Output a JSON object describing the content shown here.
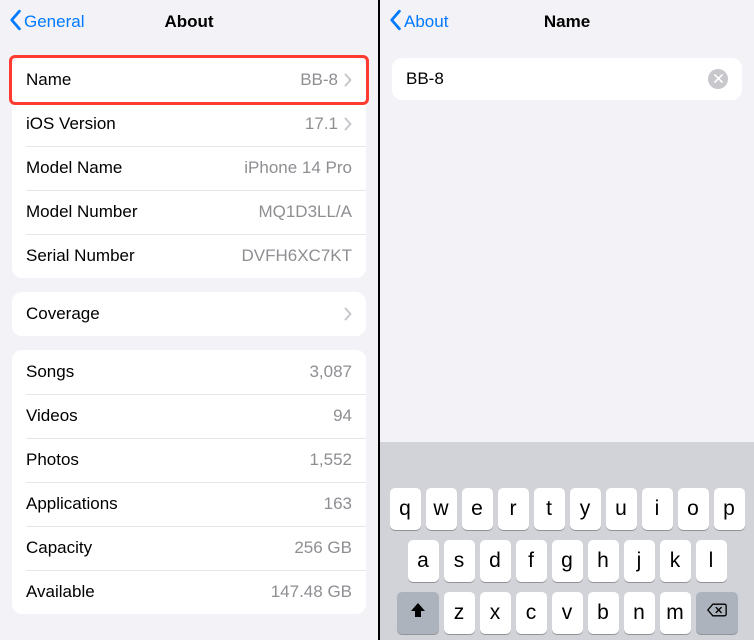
{
  "left": {
    "back_label": "General",
    "title": "About",
    "group1": [
      {
        "label": "Name",
        "value": "BB-8",
        "chevron": true,
        "highlight": true
      },
      {
        "label": "iOS Version",
        "value": "17.1",
        "chevron": true
      },
      {
        "label": "Model Name",
        "value": "iPhone 14 Pro",
        "chevron": false
      },
      {
        "label": "Model Number",
        "value": "MQ1D3LL/A",
        "chevron": false
      },
      {
        "label": "Serial Number",
        "value": "DVFH6XC7KT",
        "chevron": false
      }
    ],
    "group2": [
      {
        "label": "Coverage",
        "value": "",
        "chevron": true
      }
    ],
    "group3": [
      {
        "label": "Songs",
        "value": "3,087",
        "chevron": false
      },
      {
        "label": "Videos",
        "value": "94",
        "chevron": false
      },
      {
        "label": "Photos",
        "value": "1,552",
        "chevron": false
      },
      {
        "label": "Applications",
        "value": "163",
        "chevron": false
      },
      {
        "label": "Capacity",
        "value": "256 GB",
        "chevron": false
      },
      {
        "label": "Available",
        "value": "147.48 GB",
        "chevron": false
      }
    ]
  },
  "right": {
    "back_label": "About",
    "title": "Name",
    "name_value": "BB-8",
    "keyboard_rows": [
      [
        "q",
        "w",
        "e",
        "r",
        "t",
        "y",
        "u",
        "i",
        "o",
        "p"
      ],
      [
        "a",
        "s",
        "d",
        "f",
        "g",
        "h",
        "j",
        "k",
        "l"
      ],
      [
        "z",
        "x",
        "c",
        "v",
        "b",
        "n",
        "m"
      ]
    ]
  }
}
